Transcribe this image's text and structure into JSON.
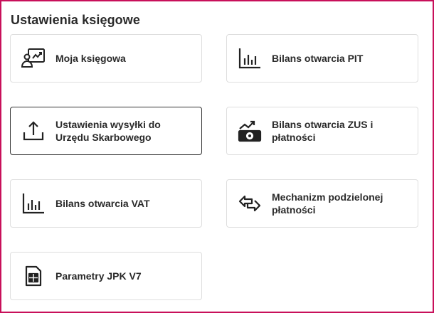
{
  "page": {
    "title": "Ustawienia księgowe"
  },
  "cards": [
    {
      "label": "Moja księgowa",
      "icon": "accountant-icon"
    },
    {
      "label": "Bilans otwarcia PIT",
      "icon": "bar-chart-icon"
    },
    {
      "label": "Ustawienia wysyłki do Urzędu Skarbowego",
      "icon": "upload-icon"
    },
    {
      "label": "Bilans otwarcia ZUS i płatności",
      "icon": "money-trend-icon"
    },
    {
      "label": "Bilans otwarcia VAT",
      "icon": "bar-chart-icon"
    },
    {
      "label": "Mechanizm podzielonej płatności",
      "icon": "swap-arrows-icon"
    },
    {
      "label": "Parametry JPK V7",
      "icon": "spreadsheet-file-icon"
    }
  ],
  "colors": {
    "frame": "#c8105a",
    "card_border": "#dedede",
    "active_border": "#333333",
    "text": "#2a2a2a"
  }
}
